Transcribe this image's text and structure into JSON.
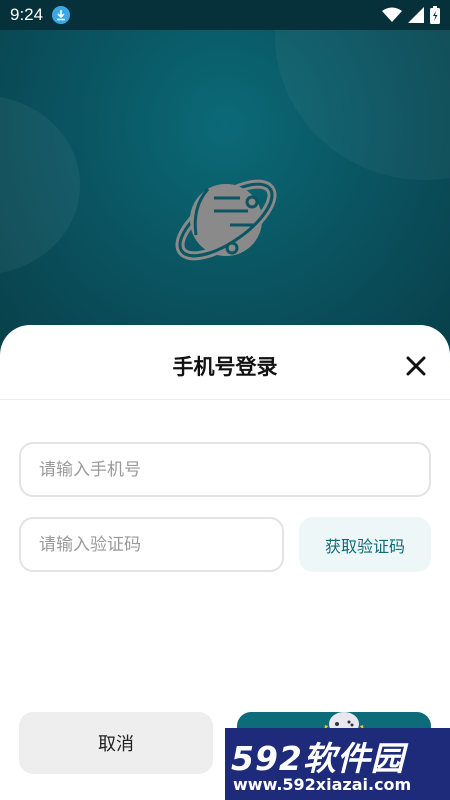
{
  "status_bar": {
    "time": "9:24"
  },
  "login": {
    "title": "手机号登录",
    "phone_placeholder": "请输入手机号",
    "code_placeholder": "请输入验证码",
    "get_code_label": "获取验证码",
    "cancel_label": "取消"
  },
  "watermark": {
    "brand_digits": "592",
    "brand_text": "软件园",
    "url": "www.592xiazai.com"
  },
  "colors": {
    "header_bg": "#0a5562",
    "accent": "#0f6b78",
    "get_code_bg": "#eef7f8",
    "cancel_bg": "#eeeeee",
    "watermark_bg": "#1d2b7a"
  },
  "icons": [
    "download-icon",
    "wifi-icon",
    "signal-icon",
    "battery-icon",
    "planet-logo-icon",
    "close-icon",
    "gamepad-icon"
  ]
}
